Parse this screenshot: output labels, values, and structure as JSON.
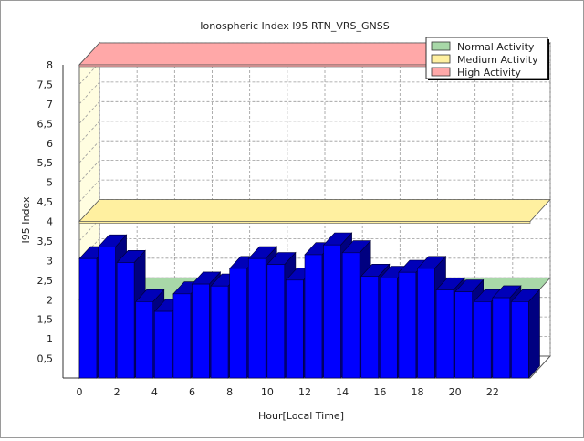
{
  "chart_data": {
    "type": "bar",
    "title": "Ionospheric Index I95 RTN_VRS_GNSS",
    "xlabel": "Hour[Local Time]",
    "ylabel": "I95 Index",
    "ylim": [
      0,
      8
    ],
    "yticks": [
      "0,5",
      "1",
      "1,5",
      "2",
      "2,5",
      "3",
      "3,5",
      "4",
      "4,5",
      "5",
      "5,5",
      "6",
      "6,5",
      "7",
      "7,5",
      "8"
    ],
    "xticks": [
      "0",
      "2",
      "4",
      "6",
      "8",
      "10",
      "12",
      "14",
      "16",
      "18",
      "20",
      "22"
    ],
    "x": [
      0,
      1,
      2,
      3,
      4,
      5,
      6,
      7,
      8,
      9,
      10,
      11,
      12,
      13,
      14,
      15,
      16,
      17,
      18,
      19,
      20,
      21,
      22,
      23
    ],
    "values": [
      3.05,
      3.35,
      2.95,
      1.95,
      1.7,
      2.15,
      2.4,
      2.35,
      2.8,
      3.05,
      2.9,
      2.5,
      3.15,
      3.4,
      3.2,
      2.6,
      2.55,
      2.7,
      2.8,
      2.25,
      2.2,
      1.95,
      2.05,
      1.95
    ],
    "bands": [
      {
        "name": "Normal Activity",
        "y": 2.0,
        "color": "#a8d8a8"
      },
      {
        "name": "Medium Activity",
        "y": 4.0,
        "color": "#fff0a0"
      },
      {
        "name": "High Activity",
        "y": 8.0,
        "color": "#ffa8a8"
      }
    ],
    "bar_color": "#0000ff",
    "grid": true,
    "legend_position": "top-right",
    "legend": [
      "Normal Activity",
      "Medium Activity",
      "High Activity"
    ]
  }
}
